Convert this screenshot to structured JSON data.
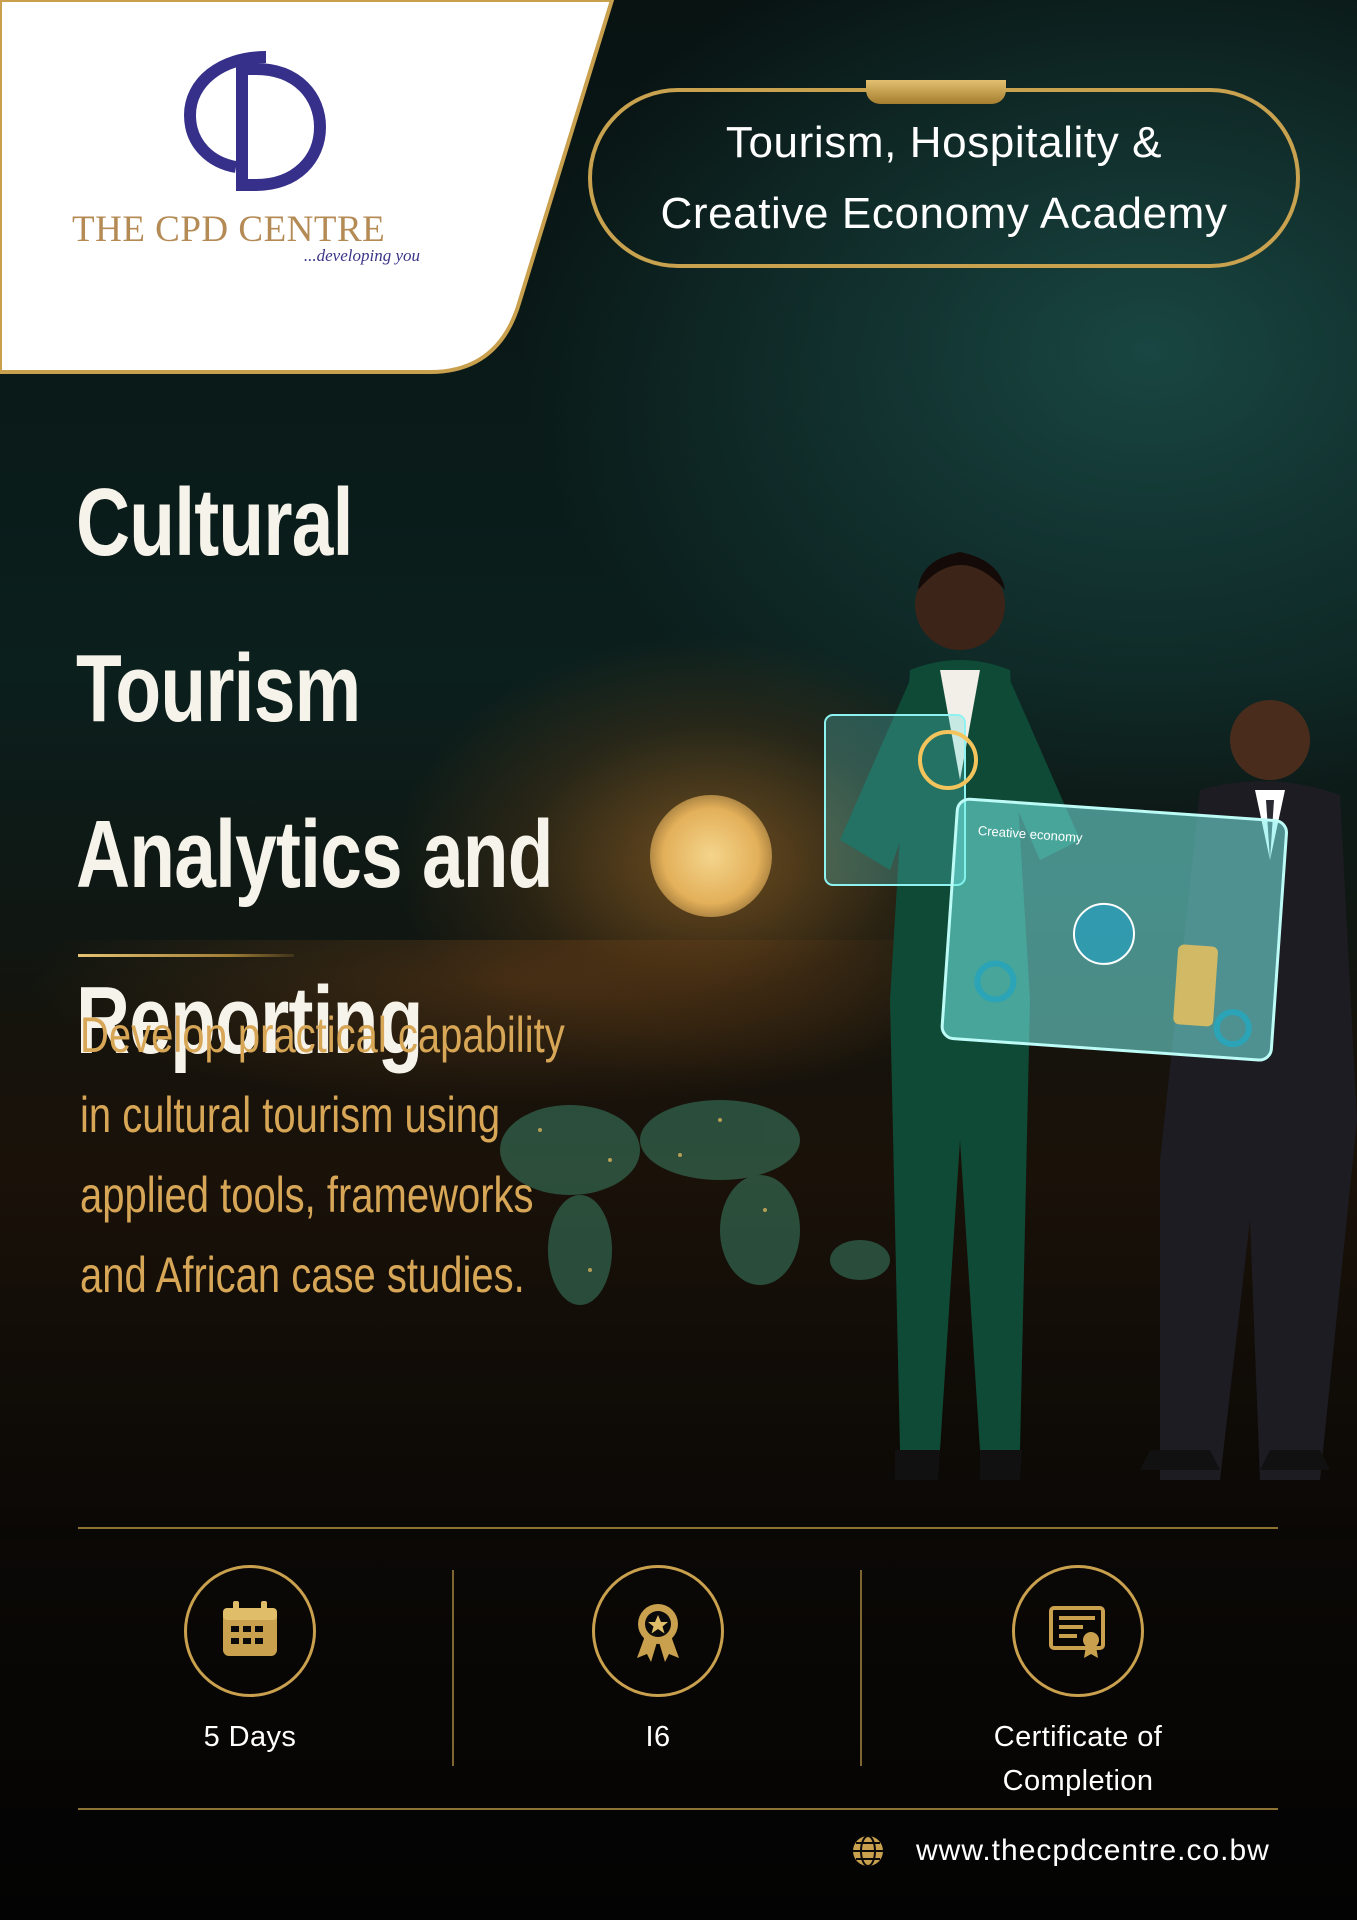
{
  "brand": {
    "name": "THE CPD CENTRE",
    "tagline": "...developing you",
    "logo_colors": {
      "mark": "#36308a",
      "name": "#b48a55"
    }
  },
  "academy": {
    "label": "Tourism, Hospitality &\nCreative Economy Academy"
  },
  "course": {
    "title": "Cultural Tourism\nAnalytics and\nReporting",
    "description": "Develop practical capability\nin cultural tourism using\napplied tools, frameworks\nand African case studies."
  },
  "features": [
    {
      "icon": "calendar-icon",
      "label": "5 Days"
    },
    {
      "icon": "award-badge-icon",
      "label": "I6"
    },
    {
      "icon": "certificate-icon",
      "label": "Certificate of\nCompletion"
    }
  ],
  "screen_heading": "Creative economy",
  "footer": {
    "icon": "globe-icon",
    "url": "www.thecpdcentre.co.bw"
  },
  "colors": {
    "gold": "#c9a04e",
    "background": "#07100f",
    "accent_text": "#d7a656"
  }
}
